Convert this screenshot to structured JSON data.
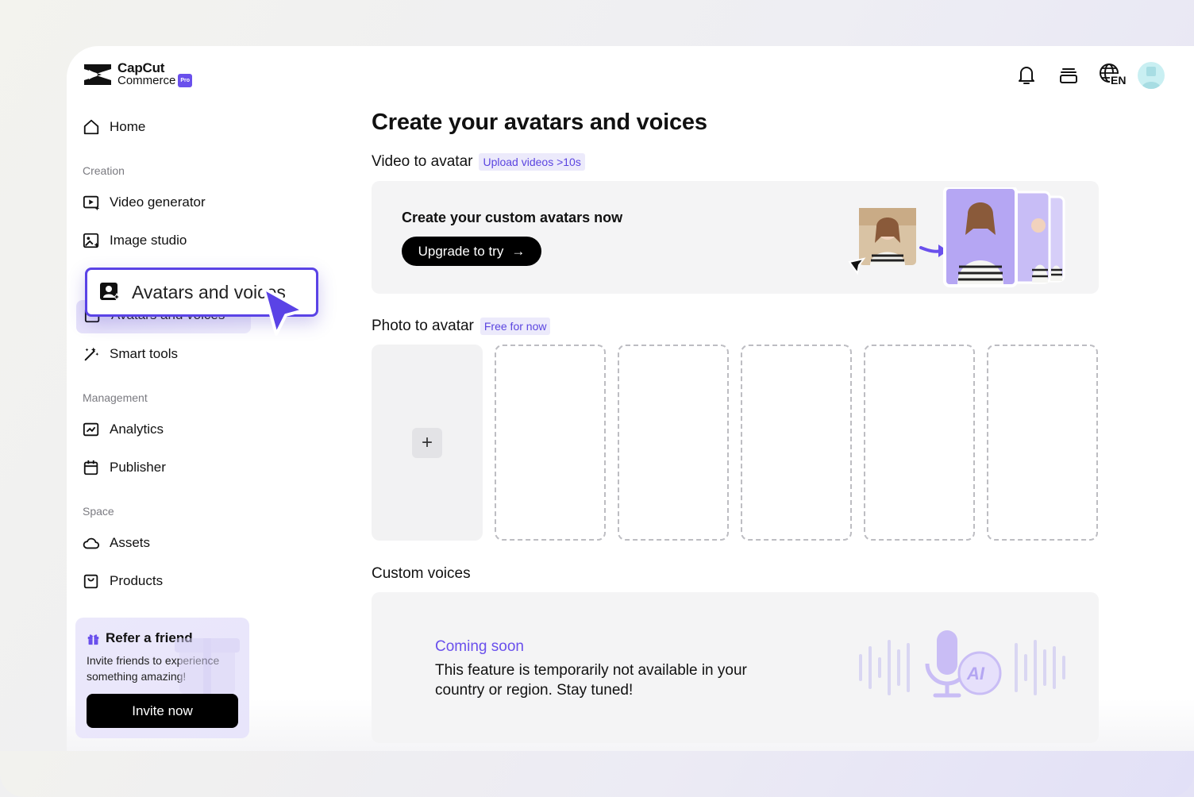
{
  "brand": {
    "line1": "CapCut",
    "line2": "Commerce",
    "badge": "Pro"
  },
  "sidebar": {
    "home": "Home",
    "sections": {
      "creation": "Creation",
      "management": "Management",
      "space": "Space"
    },
    "items": {
      "video_generator": "Video generator",
      "image_studio": "Image studio",
      "avatars_and_voices": "Avatars and voices",
      "smart_tools": "Smart tools",
      "analytics": "Analytics",
      "publisher": "Publisher",
      "assets": "Assets",
      "products": "Products"
    },
    "refer": {
      "title": "Refer a friend",
      "description": "Invite friends to experience something amazing!",
      "button": "Invite now"
    }
  },
  "header": {
    "icons": [
      "bell-icon",
      "layers-icon",
      "language-icon",
      "user-avatar"
    ],
    "language": "EN"
  },
  "main": {
    "title": "Create your avatars and voices",
    "video_to_avatar": {
      "label": "Video to avatar",
      "tag": "Upload videos >10s",
      "card_title": "Create your custom avatars now",
      "button": "Upgrade to try",
      "button_icon": "→"
    },
    "photo_to_avatar": {
      "label": "Photo to avatar",
      "tag": "Free for now",
      "add_icon": "+",
      "empty_slots": 5
    },
    "custom_voices": {
      "label": "Custom voices",
      "status": "Coming soon",
      "message": "This feature is temporarily not available in your country or region. Stay tuned!",
      "art_label": "AI"
    }
  },
  "colors": {
    "accent": "#5a43e6",
    "tag_text": "#5b45e0",
    "tag_bg": "#eceafb",
    "coming_soon": "#6a50ec"
  }
}
